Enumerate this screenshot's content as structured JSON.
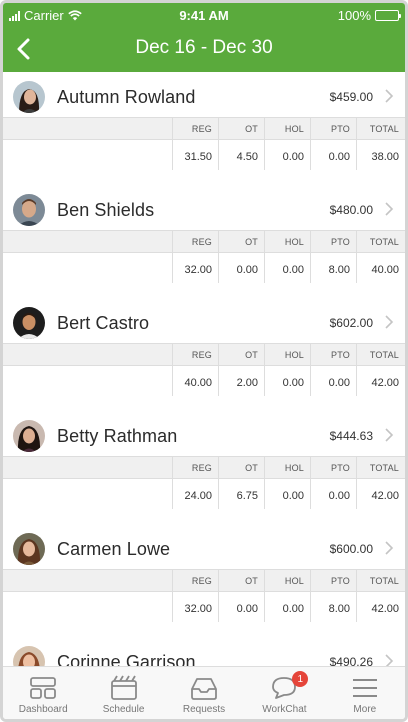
{
  "status_bar": {
    "carrier": "Carrier",
    "time": "9:41 AM",
    "battery": "100%"
  },
  "nav": {
    "title": "Dec 16 - Dec 30"
  },
  "columns": [
    "REG",
    "OT",
    "HOL",
    "PTO",
    "TOTAL"
  ],
  "employees": [
    {
      "name": "Autumn Rowland",
      "amount": "$459.00",
      "values": [
        "31.50",
        "4.50",
        "0.00",
        "0.00",
        "38.00"
      ]
    },
    {
      "name": "Ben Shields",
      "amount": "$480.00",
      "values": [
        "32.00",
        "0.00",
        "0.00",
        "8.00",
        "40.00"
      ]
    },
    {
      "name": "Bert Castro",
      "amount": "$602.00",
      "values": [
        "40.00",
        "2.00",
        "0.00",
        "0.00",
        "42.00"
      ]
    },
    {
      "name": "Betty Rathman",
      "amount": "$444.63",
      "values": [
        "24.00",
        "6.75",
        "0.00",
        "0.00",
        "42.00"
      ]
    },
    {
      "name": "Carmen Lowe",
      "amount": "$600.00",
      "values": [
        "32.00",
        "0.00",
        "0.00",
        "8.00",
        "42.00"
      ]
    },
    {
      "name": "Corinne Garrison",
      "amount": "$490.26",
      "values": [
        "",
        "",
        "",
        "",
        ""
      ]
    }
  ],
  "tabbar": {
    "tabs": [
      {
        "label": "Dashboard",
        "icon": "dashboard-icon"
      },
      {
        "label": "Schedule",
        "icon": "schedule-icon"
      },
      {
        "label": "Requests",
        "icon": "requests-icon"
      },
      {
        "label": "WorkChat",
        "icon": "workchat-icon",
        "badge": "1"
      },
      {
        "label": "More",
        "icon": "menu-icon"
      }
    ]
  },
  "colors": {
    "brand_green": "#5aaa3c",
    "badge_red": "#e5453a"
  }
}
